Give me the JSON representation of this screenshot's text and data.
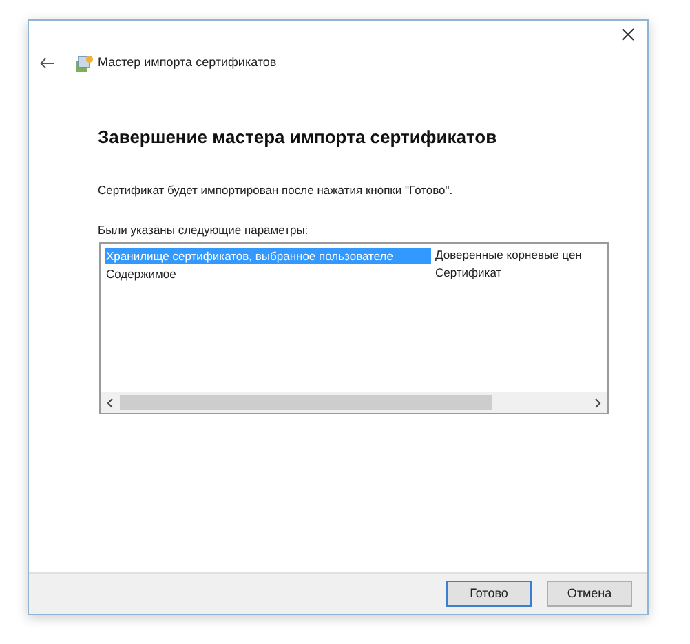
{
  "window": {
    "title": "Мастер импорта сертификатов"
  },
  "heading": "Завершение мастера импорта сертификатов",
  "message": "Сертификат будет импортирован после нажатия кнопки \"Готово\".",
  "list_label": "Были указаны следующие параметры:",
  "rows": [
    {
      "column_1": "Хранилище сертификатов, выбранное пользователе",
      "column_2": "Доверенные корневые цен",
      "selected": true
    },
    {
      "column_1": "Содержимое",
      "column_2": "Сертификат",
      "selected": false
    }
  ],
  "buttons": [
    {
      "label": "Готово",
      "default": true
    },
    {
      "label": "Отмена",
      "default": false
    }
  ]
}
